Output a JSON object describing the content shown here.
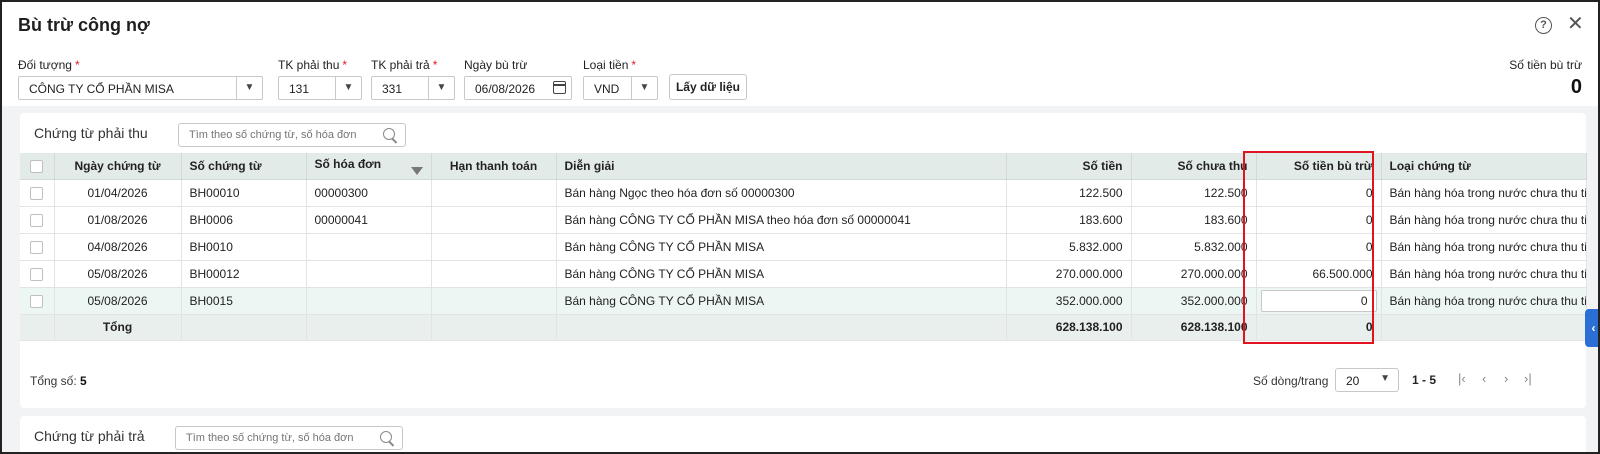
{
  "dialog": {
    "title": "Bù trừ công nợ"
  },
  "filters": {
    "doi_tuong": {
      "label": "Đối tượng",
      "value": "CÔNG TY CỔ PHẦN MISA"
    },
    "tk_phai_thu": {
      "label": "TK phải thu",
      "value": "131"
    },
    "tk_phai_tra": {
      "label": "TK phải trả",
      "value": "331"
    },
    "ngay_bu_tru": {
      "label": "Ngày bù trừ",
      "value": "06/08/2026"
    },
    "loai_tien": {
      "label": "Loại tiền",
      "value": "VND"
    },
    "fetch_button": "Lấy dữ liệu",
    "required_mark": "*",
    "so_tien_bu_tru": {
      "label": "Số tiền bù trừ",
      "value": "0"
    }
  },
  "receivables": {
    "title": "Chứng từ phải thu",
    "search_placeholder": "Tìm theo số chứng từ, số hóa đơn",
    "columns": {
      "ngay": "Ngày chứng từ",
      "so_ct": "Số chứng từ",
      "so_hd": "Số hóa đơn",
      "han": "Hạn thanh toán",
      "dien_giai": "Diễn giải",
      "so_tien": "Số tiền",
      "chua_thu": "Số chưa thu",
      "bu_tru": "Số tiền bù trừ",
      "loai": "Loại chứng từ"
    },
    "rows": [
      {
        "ngay": "01/04/2026",
        "so_ct": "BH00010",
        "so_hd": "00000300",
        "han": "",
        "dien_giai": "Bán hàng Ngọc theo hóa đơn số 00000300",
        "so_tien": "122.500",
        "chua_thu": "122.500",
        "bu_tru": "0",
        "loai": "Bán hàng hóa trong nước chưa thu tiền"
      },
      {
        "ngay": "01/08/2026",
        "so_ct": "BH0006",
        "so_hd": "00000041",
        "han": "",
        "dien_giai": "Bán hàng CÔNG TY CỔ PHẦN MISA theo hóa đơn số 00000041",
        "so_tien": "183.600",
        "chua_thu": "183.600",
        "bu_tru": "0",
        "loai": "Bán hàng hóa trong nước chưa thu tiền"
      },
      {
        "ngay": "04/08/2026",
        "so_ct": "BH0010",
        "so_hd": "",
        "han": "",
        "dien_giai": "Bán hàng CÔNG TY CỔ PHẦN MISA",
        "so_tien": "5.832.000",
        "chua_thu": "5.832.000",
        "bu_tru": "0",
        "loai": "Bán hàng hóa trong nước chưa thu tiền"
      },
      {
        "ngay": "05/08/2026",
        "so_ct": "BH00012",
        "so_hd": "",
        "han": "",
        "dien_giai": "Bán hàng CÔNG TY CỔ PHẦN MISA",
        "so_tien": "270.000.000",
        "chua_thu": "270.000.000",
        "bu_tru": "66.500.000",
        "loai": "Bán hàng hóa trong nước chưa thu tiền"
      },
      {
        "ngay": "05/08/2026",
        "so_ct": "BH0015",
        "so_hd": "",
        "han": "",
        "dien_giai": "Bán hàng CÔNG TY CỔ PHẦN MISA",
        "so_tien": "352.000.000",
        "chua_thu": "352.000.000",
        "bu_tru": "0",
        "loai": "Bán hàng hóa trong nước chưa thu tiền"
      }
    ],
    "total": {
      "label": "Tổng",
      "so_tien": "628.138.100",
      "chua_thu": "628.138.100",
      "bu_tru": "0"
    },
    "footer": {
      "count_label": "Tổng số:",
      "count": "5",
      "rows_per_page_label": "Số dòng/trang",
      "rows_per_page": "20",
      "page_range": "1 - 5"
    }
  },
  "payables": {
    "title": "Chứng từ phải trả",
    "search_placeholder": "Tìm theo số chứng từ, số hóa đơn"
  },
  "icons": {
    "help": "help-circle-icon",
    "close": "close-icon",
    "chevron": "chevron-down-icon",
    "calendar": "calendar-icon",
    "search": "search-icon",
    "filter": "filter-icon",
    "side_tab": "chevron-left-icon"
  },
  "colors": {
    "header_bg": "#e3ebe9",
    "link": "#3461c1",
    "highlight_border": "#e0141e",
    "side_tab": "#2a6ed6",
    "required": "#e02020"
  }
}
